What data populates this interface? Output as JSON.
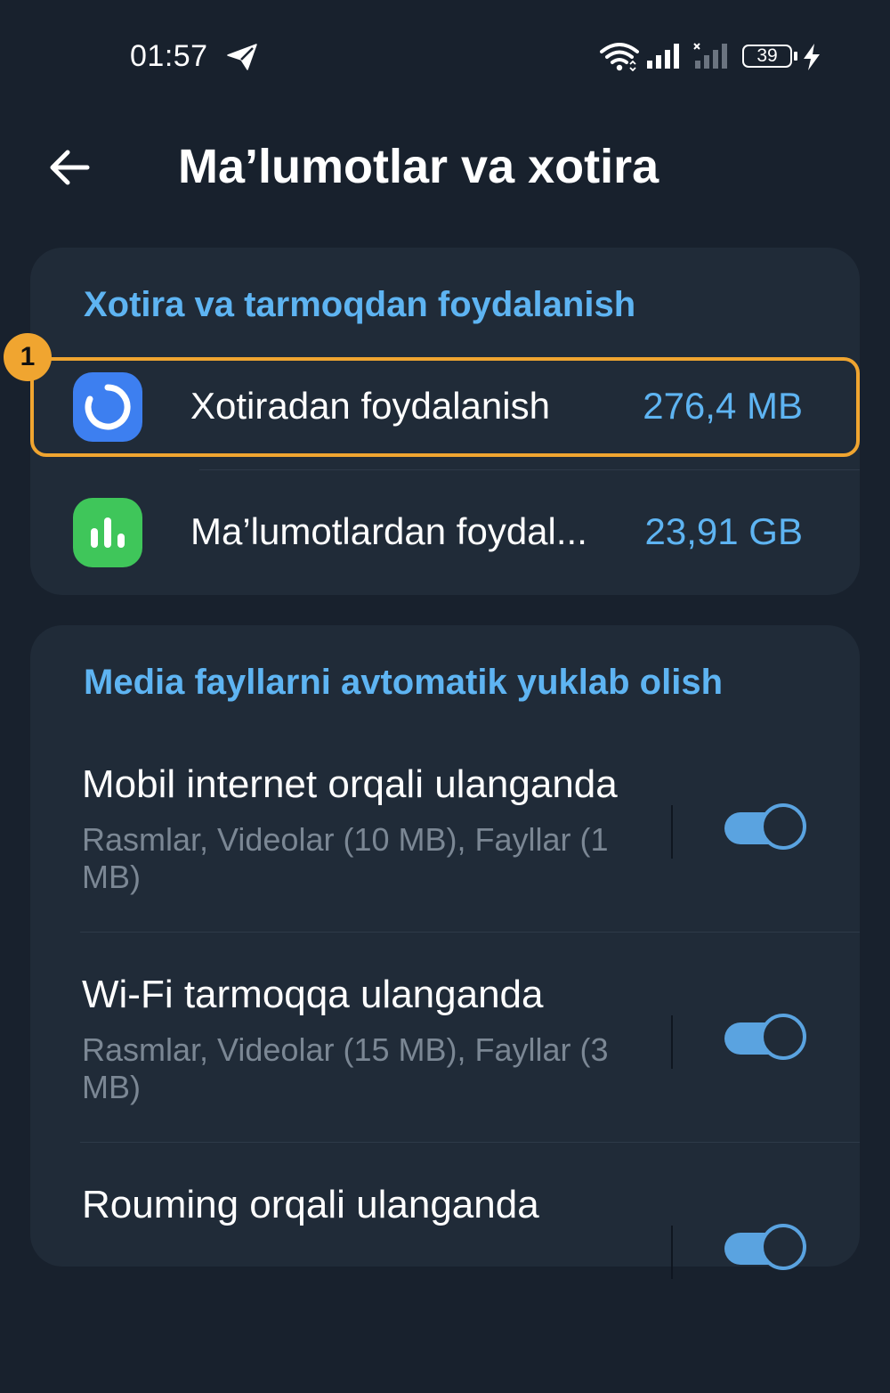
{
  "status_bar": {
    "time": "01:57",
    "battery": "39",
    "icons": [
      "telegram-send-icon",
      "wifi-icon",
      "signal-icon",
      "signal-no-service-icon",
      "battery-icon",
      "charging-bolt-icon"
    ]
  },
  "header": {
    "title": "Ma’lumotlar va xotira",
    "back_icon": "arrow-left-icon"
  },
  "usage_section": {
    "title": "Xotira va tarmoqdan foydalanish",
    "items": [
      {
        "label": "Xotiradan foydalanish",
        "value": "276,4 MB",
        "icon": "storage-ring-icon",
        "icon_color": "#3d7ff0",
        "highlighted": true,
        "badge": "1"
      },
      {
        "label": "Ma’lumotlardan foydal...",
        "value": "23,91 GB",
        "icon": "bar-chart-icon",
        "icon_color": "#3fc65a"
      }
    ]
  },
  "autodownload_section": {
    "title": "Media fayllarni avtomatik yuklab olish",
    "items": [
      {
        "title": "Mobil internet orqali ulanganda",
        "subtitle": "Rasmlar, Videolar (10 MB), Fayllar (1 MB)",
        "enabled": true
      },
      {
        "title": "Wi-Fi tarmoqqa ulanganda",
        "subtitle": "Rasmlar, Videolar (15 MB), Fayllar (3 MB)",
        "enabled": true
      },
      {
        "title": "Rouming orqali ulanganda",
        "subtitle": "",
        "enabled": true
      }
    ]
  },
  "colors": {
    "background": "#18212d",
    "card": "#202b38",
    "accent": "#5eb4f2",
    "highlight": "#f0a530",
    "toggle": "#5aa3e0"
  }
}
